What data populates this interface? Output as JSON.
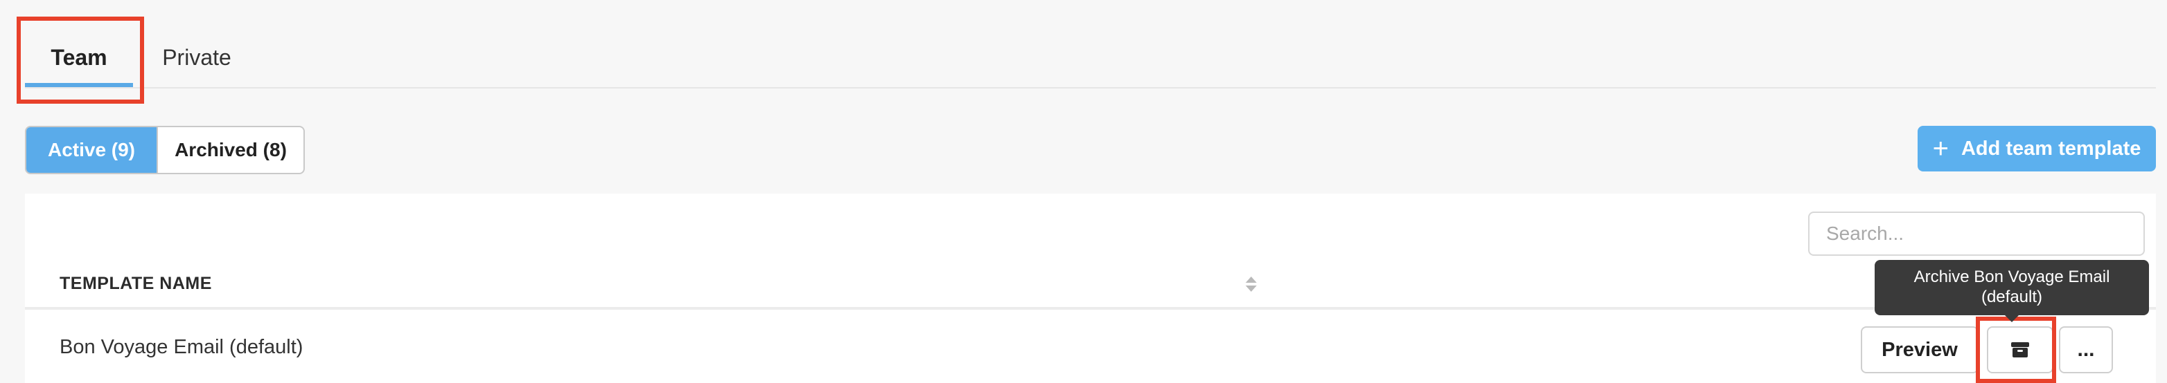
{
  "tabs": [
    {
      "label": "Team",
      "active": true
    },
    {
      "label": "Private",
      "active": false
    }
  ],
  "filters": {
    "active_label": "Active (9)",
    "archived_label": "Archived (8)"
  },
  "toolbar": {
    "add_label": "Add team template",
    "add_icon": "plus-icon"
  },
  "search": {
    "placeholder": "Search...",
    "value": ""
  },
  "table": {
    "columns": [
      "TEMPLATE NAME"
    ],
    "rows": [
      {
        "name": "Bon Voyage Email (default)"
      }
    ]
  },
  "row_actions": {
    "preview_label": "Preview",
    "archive_icon": "archive-box-icon",
    "more_label": "..."
  },
  "tooltip": {
    "text": "Archive Bon Voyage Email (default)"
  },
  "colors": {
    "accent": "#5aabea",
    "highlight": "#e8412b",
    "tooltip_bg": "#3a3a3a"
  }
}
